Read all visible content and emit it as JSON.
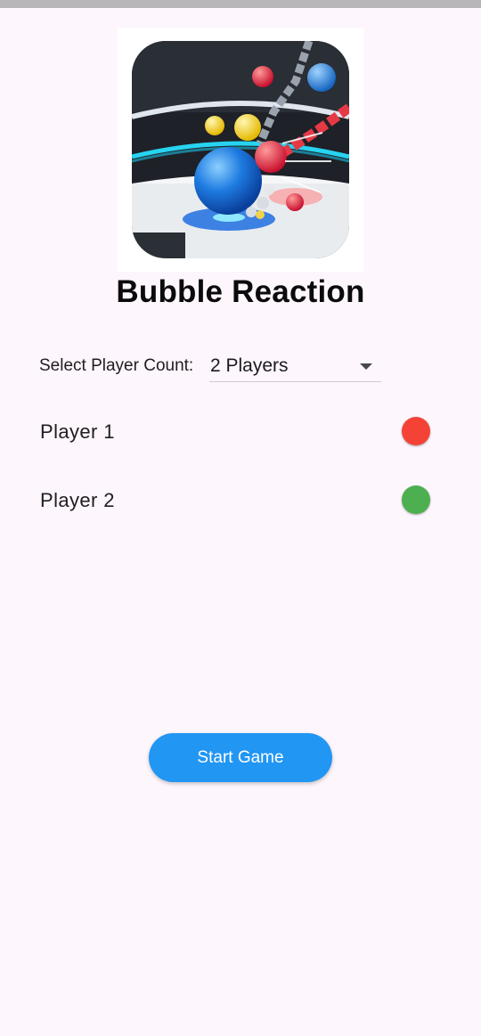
{
  "app": {
    "title": "Bubble Reaction",
    "icon": "bubble-reaction-app-icon"
  },
  "player_count": {
    "label": "Select Player Count:",
    "selected": "2 Players",
    "icon": "dropdown-arrow-icon"
  },
  "players": [
    {
      "name": "Player 1",
      "color": "#f44336"
    },
    {
      "name": "Player 2",
      "color": "#4caf50"
    }
  ],
  "start_button": {
    "label": "Start Game",
    "color": "#2196f3"
  }
}
